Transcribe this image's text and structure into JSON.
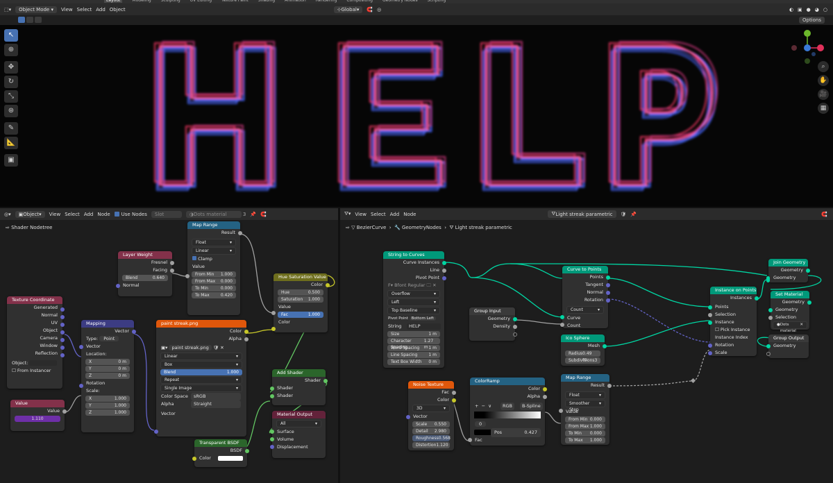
{
  "topbar": {
    "tabs": [
      "Layout",
      "Modeling",
      "Sculpting",
      "UV Editing",
      "Texture Paint",
      "Shading",
      "Animation",
      "Rendering",
      "Compositing",
      "Geometry Nodes",
      "Scripting"
    ]
  },
  "viewport_header": {
    "mode": "Object Mode",
    "menus": [
      "View",
      "Select",
      "Add",
      "Object"
    ],
    "orientation": "Global",
    "options": "Options"
  },
  "viewport": {
    "text": "HELP",
    "colors": {
      "red": "#e0305a",
      "blue": "#3a56d8",
      "pink": "#ff7fd0"
    }
  },
  "shader_editor": {
    "header": {
      "type": "Object",
      "menus": [
        "View",
        "Select",
        "Add",
        "Node"
      ],
      "use_nodes": "Use Nodes",
      "slot": "Slot",
      "material": "Dots material",
      "users": "3"
    },
    "breadcrumb": "Shader Nodetree",
    "nodes": {
      "texture_coordinate": {
        "title": "Texture Coordinate",
        "outputs": [
          "Generated",
          "Normal",
          "UV",
          "Object",
          "Camera",
          "Window",
          "Reflection"
        ],
        "object_label": "Object:",
        "from_instancer": "From Instancer"
      },
      "value": {
        "title": "Value",
        "output": "Value",
        "val": "1.110"
      },
      "layer_weight": {
        "title": "Layer Weight",
        "outputs": [
          "Fresnel",
          "Facing"
        ],
        "blend_label": "Blend",
        "blend": "0.640",
        "normal": "Normal"
      },
      "mapping": {
        "title": "Mapping",
        "output": "Vector",
        "type_label": "Type:",
        "type": "Point",
        "vector": "Vector",
        "location": "Location:",
        "loc": [
          [
            "X",
            "0 m"
          ],
          [
            "Y",
            "0 m"
          ],
          [
            "Z",
            "0 m"
          ]
        ],
        "rotation": "Rotation",
        "scale": "Scale:",
        "scl": [
          [
            "X",
            "1.000"
          ],
          [
            "Y",
            "1.000"
          ],
          [
            "Z",
            "1.000"
          ]
        ]
      },
      "map_range": {
        "title": "Map Range",
        "output": "Result",
        "dtype": "Float",
        "interp": "Linear",
        "clamp": "Clamp",
        "value": "Value",
        "fields": [
          [
            "From Min",
            "1.000"
          ],
          [
            "From Max",
            "0.000"
          ],
          [
            "To Min",
            "0.000"
          ],
          [
            "To Max",
            "0.420"
          ]
        ]
      },
      "image_texture": {
        "title": "paint streak.png",
        "outputs": [
          "Color",
          "Alpha"
        ],
        "image": "paint streak.png",
        "interp": "Linear",
        "proj": "Box",
        "blend_label": "Blend",
        "blend": "1.000",
        "ext": "Repeat",
        "source": "Single Image",
        "cs_label": "Color Space",
        "cs": "sRGB",
        "alpha_label": "Alpha",
        "alpha": "Straight",
        "vector": "Vector"
      },
      "hue_sat": {
        "title": "Hue Saturation Value",
        "output": "Color",
        "fields": [
          [
            "Hue",
            "0.500"
          ],
          [
            "Saturation",
            "1.000"
          ]
        ],
        "value": "Value",
        "fac_label": "Fac",
        "fac": "1.000",
        "color": "Color"
      },
      "add_shader": {
        "title": "Add Shader",
        "output": "Shader",
        "inputs": [
          "Shader",
          "Shader"
        ]
      },
      "material_output": {
        "title": "Material Output",
        "target": "All",
        "inputs": [
          "Surface",
          "Volume",
          "Displacement"
        ]
      },
      "transparent": {
        "title": "Transparent BSDF",
        "output": "BSDF",
        "color": "Color"
      }
    }
  },
  "geo_editor": {
    "header": {
      "menus": [
        "View",
        "Select",
        "Add",
        "Node"
      ],
      "tree": "Light streak parametric"
    },
    "breadcrumb": [
      "BezierCurve",
      "GeometryNodes",
      "Light streak parametric"
    ],
    "nodes": {
      "string_to_curves": {
        "title": "String to Curves",
        "outputs": [
          "Curve Instances",
          "Line",
          "Pivot Point"
        ],
        "font": "Bfont Regular",
        "overflow": "Overflow",
        "align_x": "Left",
        "align_y": "Top Baseline",
        "pivot_label": "Pivot Point",
        "pivot": "Bottom Left",
        "string_label": "String",
        "string": "HELP",
        "fields": [
          [
            "Size",
            "1 m"
          ],
          [
            "Character Spacing",
            "1.27 m"
          ],
          [
            "Word Spacing",
            "1 m"
          ],
          [
            "Line Spacing",
            "1 m"
          ],
          [
            "Text Box Width",
            "0 m"
          ]
        ]
      },
      "group_input": {
        "title": "Group Input",
        "outputs": [
          "Geometry",
          "Density"
        ]
      },
      "curve_to_points": {
        "title": "Curve to Points",
        "outputs": [
          "Points",
          "Tangent",
          "Normal",
          "Rotation"
        ],
        "mode": "Count",
        "inputs": [
          "Curve",
          "Count"
        ]
      },
      "ico_sphere": {
        "title": "Ico Sphere",
        "output": "Mesh",
        "fields": [
          [
            "Radius",
            "0.49 m"
          ],
          [
            "Subdivisions",
            "3"
          ]
        ]
      },
      "instance_on_points": {
        "title": "Instance on Points",
        "output": "Instances",
        "inputs": [
          "Points",
          "Selection",
          "Instance",
          "Pick Instance",
          "Instance Index",
          "Rotation",
          "Scale"
        ]
      },
      "join_geometry": {
        "title": "Join Geometry",
        "output": "Geometry",
        "input": "Geometry"
      },
      "set_material": {
        "title": "Set Material",
        "output": "Geometry",
        "inputs": [
          "Geometry",
          "Selection"
        ],
        "material": "Dots material"
      },
      "group_output": {
        "title": "Group Output",
        "input": "Geometry"
      },
      "noise_texture": {
        "title": "Noise Texture",
        "outputs": [
          "Fac",
          "Color"
        ],
        "dim": "3D",
        "vector": "Vector",
        "fields": [
          [
            "Scale",
            "0.550"
          ],
          [
            "Detail",
            "2.980"
          ],
          [
            "Roughness",
            "0.568"
          ],
          [
            "Distortion",
            "1.120"
          ]
        ]
      },
      "color_ramp": {
        "title": "ColorRamp",
        "outputs": [
          "Color",
          "Alpha"
        ],
        "mode": "RGB",
        "interp": "B-Spline",
        "stop": "0",
        "pos_label": "Pos",
        "pos": "0.427",
        "fac": "Fac"
      },
      "map_range": {
        "title": "Map Range",
        "output": "Result",
        "dtype": "Float",
        "interp": "Smoother Step",
        "value": "Value",
        "fields": [
          [
            "From Min",
            "0.000"
          ],
          [
            "From Max",
            "1.000"
          ],
          [
            "To Min",
            "0.000"
          ],
          [
            "To Max",
            "1.000"
          ]
        ]
      }
    }
  }
}
